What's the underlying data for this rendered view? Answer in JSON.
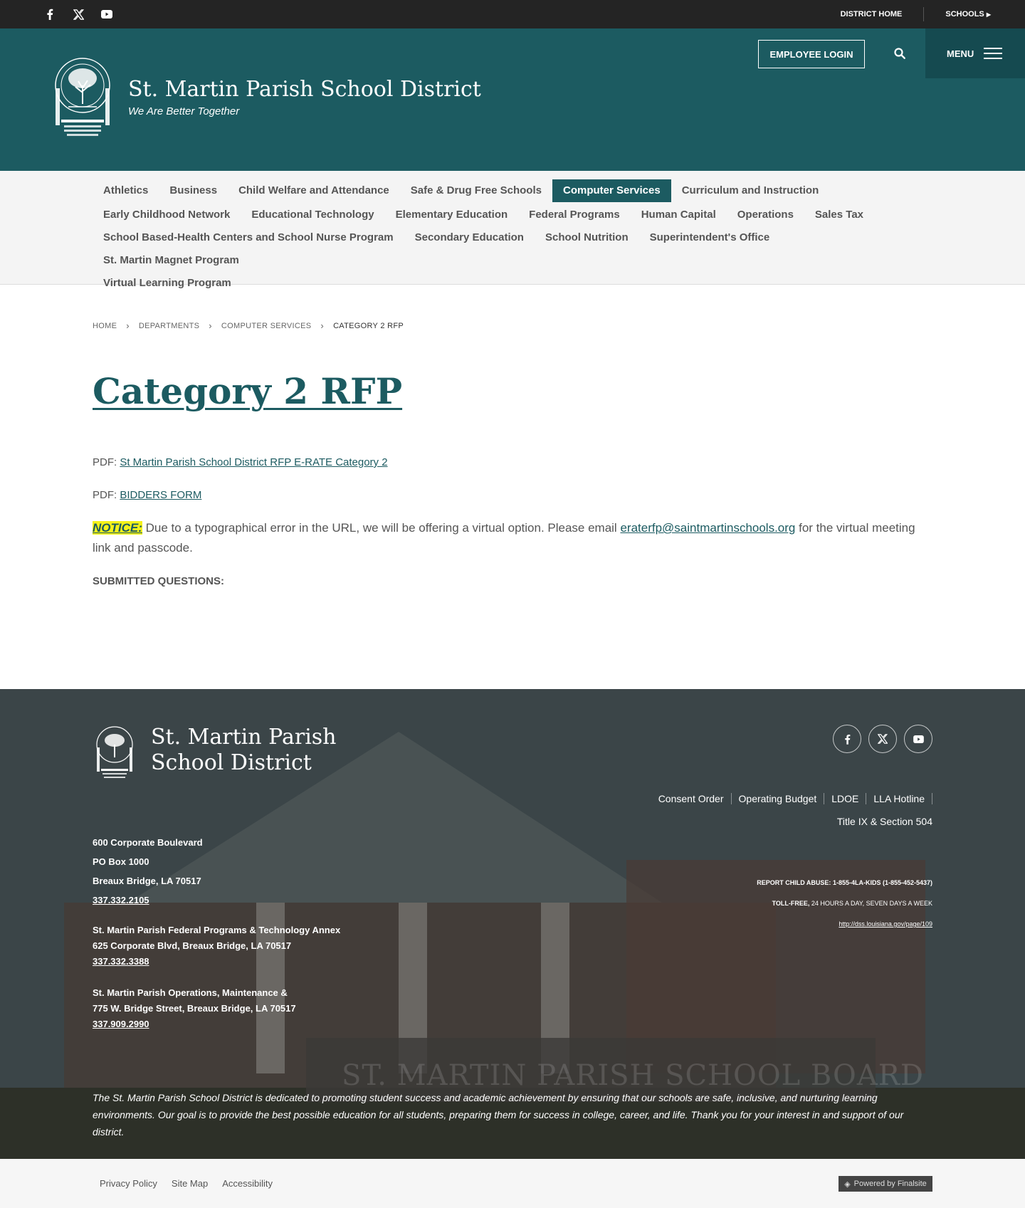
{
  "topbar": {
    "social": [
      "facebook-icon",
      "x-icon",
      "youtube-icon"
    ],
    "district_home": "DISTRICT HOME",
    "schools": "SCHOOLS"
  },
  "header": {
    "title": "St. Martin Parish School District",
    "tagline": "We Are Better Together",
    "employee_login": "EMPLOYEE LOGIN",
    "menu": "MENU"
  },
  "departments": [
    "Athletics",
    "Business",
    "Child Welfare and Attendance",
    "Safe & Drug Free Schools",
    "Computer Services",
    "Curriculum and Instruction",
    "Early Childhood Network",
    "Educational Technology",
    "Elementary Education",
    "Federal Programs",
    "Human Capital",
    "Operations",
    "Sales Tax",
    "School Based-Health Centers and School Nurse Program",
    "Secondary Education",
    "School Nutrition",
    "Superintendent's Office",
    "St. Martin Magnet Program",
    "Virtual Learning Program"
  ],
  "breadcrumb": {
    "home": "HOME",
    "departments": "DEPARTMENTS",
    "computer_services": "COMPUTER SERVICES",
    "current": "CATEGORY 2 RFP"
  },
  "page": {
    "title": "Category 2 RFP",
    "pdf_prefix": "PDF:",
    "pdf1": "St Martin Parish School District RFP E-RATE Category 2",
    "pdf2": "BIDDERS FORM",
    "notice_label": "NOTICE:",
    "notice_text": "Due to a typographical error in the URL, we will be offering a virtual option. Please email",
    "notice_email": "eraterfp@saintmartinschools.org",
    "notice_tail": "for the virtual meeting link and passcode.",
    "submitted": "SUBMITTED QUESTIONS:"
  },
  "footer": {
    "title": "St. Martin Parish School District",
    "links": [
      "Consent Order",
      "Operating Budget",
      "LDOE",
      "LLA Hotline"
    ],
    "title_ix": "Title IX & Section 504",
    "address1": "600 Corporate Boulevard",
    "address2": "PO Box 1000",
    "address3": "Breaux Bridge, LA  70517",
    "phone1": "337.332.2105",
    "annex_name": "St. Martin Parish Federal Programs & Technology Annex",
    "annex_addr": "625 Corporate Blvd, Breaux Bridge, LA  70517",
    "phone2": "337.332.3388",
    "ops_name": "St. Martin Parish Operations, Maintenance &",
    "ops_addr": "775 W. Bridge Street, Breaux Bridge, LA  70517",
    "phone3": "337.909.2990",
    "report_label": "REPORT CHILD ABUSE:",
    "report_number": "1-855-4LA-KIDS (1-855-452-5437)",
    "tollfree_label": "TOLL-FREE,",
    "tollfree_text": "24 HOURS A DAY, SEVEN DAYS A WEEK",
    "report_url": "http://dss.louisiana.gov/page/109",
    "mission": "The St. Martin Parish School District is dedicated to promoting student success and academic achievement by ensuring that our schools are safe, inclusive, and nurturing learning environments. Our goal is to provide the best possible education for all students, preparing them for success in college, career, and life. Thank you for your interest in and support of our district.",
    "sign_text": "ST. MARTIN PARISH SCHOOL BOARD"
  },
  "bottom": {
    "links": [
      "Privacy Policy",
      "Site Map",
      "Accessibility"
    ],
    "powered": "Powered by Finalsite"
  }
}
